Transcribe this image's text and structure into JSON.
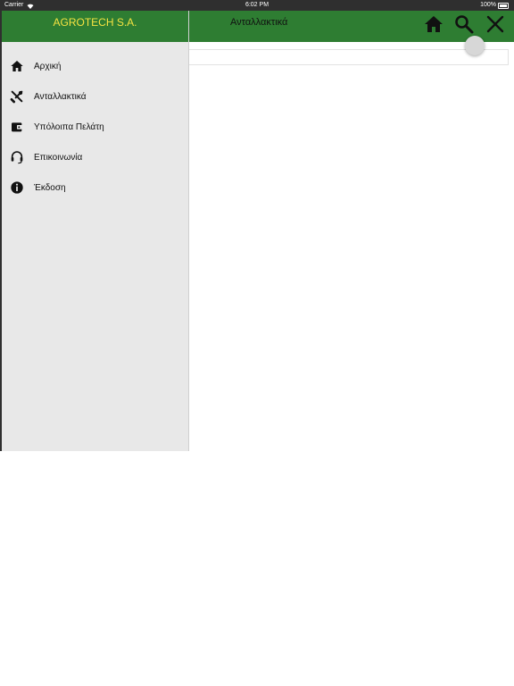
{
  "status_bar": {
    "carrier": "Carrier",
    "time": "6:02 PM",
    "battery": "100%"
  },
  "app_bar": {
    "title": "Ανταλλακτικά",
    "icons": [
      "home-icon",
      "search-icon",
      "close-icon"
    ]
  },
  "drawer": {
    "brand": "AGROTECH S.A.",
    "items": [
      {
        "label": "Αρχική",
        "icon": "home-icon"
      },
      {
        "label": "Ανταλλακτικά",
        "icon": "tools-icon"
      },
      {
        "label": "Υπόλοιπα Πελάτη",
        "icon": "wallet-icon"
      },
      {
        "label": "Επικοινωνία",
        "icon": "headset-icon"
      },
      {
        "label": "Έκδοση",
        "icon": "info-icon"
      }
    ]
  },
  "colors": {
    "primary": "#2e7d32",
    "brand_text": "#f5e342",
    "drawer_bg": "#e8e8e8",
    "status_bar": "#2f2f2f"
  }
}
